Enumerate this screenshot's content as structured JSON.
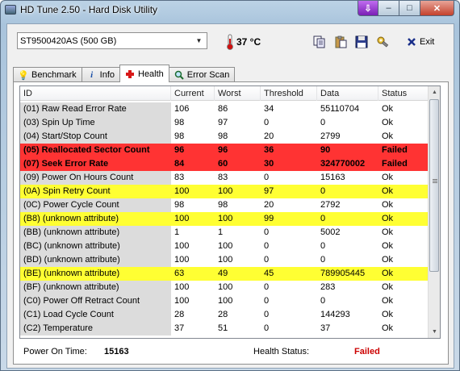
{
  "window": {
    "title": "HD Tune 2.50 - Hard Disk Utility",
    "close_label": "✕",
    "minimize_label": "–",
    "maximize_label": "□",
    "download_label": "⇩"
  },
  "toolbar": {
    "drive": "ST9500420AS (500 GB)",
    "temperature": "37 °C",
    "exit_label": "Exit"
  },
  "tabs": [
    {
      "label": "Benchmark",
      "icon": "lightbulb-icon"
    },
    {
      "label": "Info",
      "icon": "info-icon"
    },
    {
      "label": "Health",
      "icon": "health-cross-icon",
      "active": true
    },
    {
      "label": "Error Scan",
      "icon": "magnifier-icon"
    }
  ],
  "table": {
    "headers": [
      "ID",
      "Current",
      "Worst",
      "Threshold",
      "Data",
      "Status"
    ],
    "rows": [
      {
        "id": "(01) Raw Read Error Rate",
        "current": "106",
        "worst": "86",
        "threshold": "34",
        "data": "55110704",
        "status": "Ok",
        "state": "normal"
      },
      {
        "id": "(03) Spin Up Time",
        "current": "98",
        "worst": "97",
        "threshold": "0",
        "data": "0",
        "status": "Ok",
        "state": "normal"
      },
      {
        "id": "(04) Start/Stop Count",
        "current": "98",
        "worst": "98",
        "threshold": "20",
        "data": "2799",
        "status": "Ok",
        "state": "normal"
      },
      {
        "id": "(05) Reallocated Sector Count",
        "current": "96",
        "worst": "96",
        "threshold": "36",
        "data": "90",
        "status": "Failed",
        "state": "failed"
      },
      {
        "id": "(07) Seek Error Rate",
        "current": "84",
        "worst": "60",
        "threshold": "30",
        "data": "324770002",
        "status": "Failed",
        "state": "failed"
      },
      {
        "id": "(09) Power On Hours Count",
        "current": "83",
        "worst": "83",
        "threshold": "0",
        "data": "15163",
        "status": "Ok",
        "state": "normal"
      },
      {
        "id": "(0A) Spin Retry Count",
        "current": "100",
        "worst": "100",
        "threshold": "97",
        "data": "0",
        "status": "Ok",
        "state": "warn"
      },
      {
        "id": "(0C) Power Cycle Count",
        "current": "98",
        "worst": "98",
        "threshold": "20",
        "data": "2792",
        "status": "Ok",
        "state": "normal"
      },
      {
        "id": "(B8) (unknown attribute)",
        "current": "100",
        "worst": "100",
        "threshold": "99",
        "data": "0",
        "status": "Ok",
        "state": "warn"
      },
      {
        "id": "(BB) (unknown attribute)",
        "current": "1",
        "worst": "1",
        "threshold": "0",
        "data": "5002",
        "status": "Ok",
        "state": "normal"
      },
      {
        "id": "(BC) (unknown attribute)",
        "current": "100",
        "worst": "100",
        "threshold": "0",
        "data": "0",
        "status": "Ok",
        "state": "normal"
      },
      {
        "id": "(BD) (unknown attribute)",
        "current": "100",
        "worst": "100",
        "threshold": "0",
        "data": "0",
        "status": "Ok",
        "state": "normal"
      },
      {
        "id": "(BE) (unknown attribute)",
        "current": "63",
        "worst": "49",
        "threshold": "45",
        "data": "789905445",
        "status": "Ok",
        "state": "warn"
      },
      {
        "id": "(BF) (unknown attribute)",
        "current": "100",
        "worst": "100",
        "threshold": "0",
        "data": "283",
        "status": "Ok",
        "state": "normal"
      },
      {
        "id": "(C0) Power Off Retract Count",
        "current": "100",
        "worst": "100",
        "threshold": "0",
        "data": "0",
        "status": "Ok",
        "state": "normal"
      },
      {
        "id": "(C1) Load Cycle Count",
        "current": "28",
        "worst": "28",
        "threshold": "0",
        "data": "144293",
        "status": "Ok",
        "state": "normal"
      },
      {
        "id": "(C2) Temperature",
        "current": "37",
        "worst": "51",
        "threshold": "0",
        "data": "37",
        "status": "Ok",
        "state": "normal"
      }
    ]
  },
  "status": {
    "power_on_label": "Power On Time:",
    "power_on_value": "15163",
    "health_label": "Health Status:",
    "health_value": "Failed"
  },
  "colors": {
    "failed_row": "#ff3333",
    "warn_row": "#ffff33",
    "id_column_bg": "#dcdcdc",
    "failed_text": "#cc0000"
  }
}
